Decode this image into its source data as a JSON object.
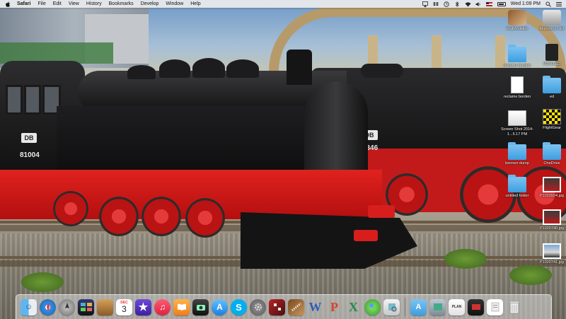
{
  "menubar": {
    "app_name": "Safari",
    "items": [
      "File",
      "Edit",
      "View",
      "History",
      "Bookmarks",
      "Develop",
      "Window",
      "Help"
    ],
    "clock": "Wed 1:09 PM"
  },
  "wallpaper": {
    "loco_front_number": "81004",
    "loco_back_number": "38 3346",
    "plate_label": "DB"
  },
  "desktop_icons": [
    {
      "label": "RailModeller",
      "icon": "railmodeller-app-icon"
    },
    {
      "label": "Macintosh HD",
      "icon": "hard-drive-icon"
    },
    {
      "label": "reclame borden",
      "icon": "folder-icon"
    },
    {
      "label": "FOTO ED",
      "icon": "sd-card-icon"
    },
    {
      "label": "reclame borden",
      "icon": "document-icon"
    },
    {
      "label": "ed",
      "icon": "folder-icon"
    },
    {
      "label": "Screen Shot 2014-1...5.17 PM",
      "icon": "screenshot-icon"
    },
    {
      "label": "FlightGear",
      "icon": "flightgear-icon"
    },
    {
      "label": "bennen dump",
      "icon": "folder-icon"
    },
    {
      "label": "OneDrive",
      "icon": "folder-icon"
    },
    {
      "label": "untitled folder",
      "icon": "folder-icon"
    },
    {
      "label": "P1010924.jpg",
      "icon": "image-icon"
    },
    {
      "label": "P1020740.jpg",
      "icon": "image-icon"
    },
    {
      "label": "P1020741.jpg",
      "icon": "image-icon"
    }
  ],
  "dock": {
    "calendar_day": "3",
    "calendar_month": "DEC",
    "plan_label": "PLAN",
    "apps": [
      "finder",
      "safari",
      "launchpad",
      "mission-control",
      "notes",
      "calendar",
      "imovie",
      "itunes",
      "ibooks",
      "photo-booth",
      "app-store",
      "skype",
      "system-preferences",
      "game",
      "railmodeller",
      "word",
      "powerpoint",
      "excel",
      "messenger",
      "preview",
      "applications-folder",
      "image-capture",
      "plan",
      "photos",
      "document",
      "trash"
    ]
  },
  "colors": {
    "folder": "#3d9ee0",
    "loco_red": "#c21a1a",
    "loco_black": "#141415"
  }
}
